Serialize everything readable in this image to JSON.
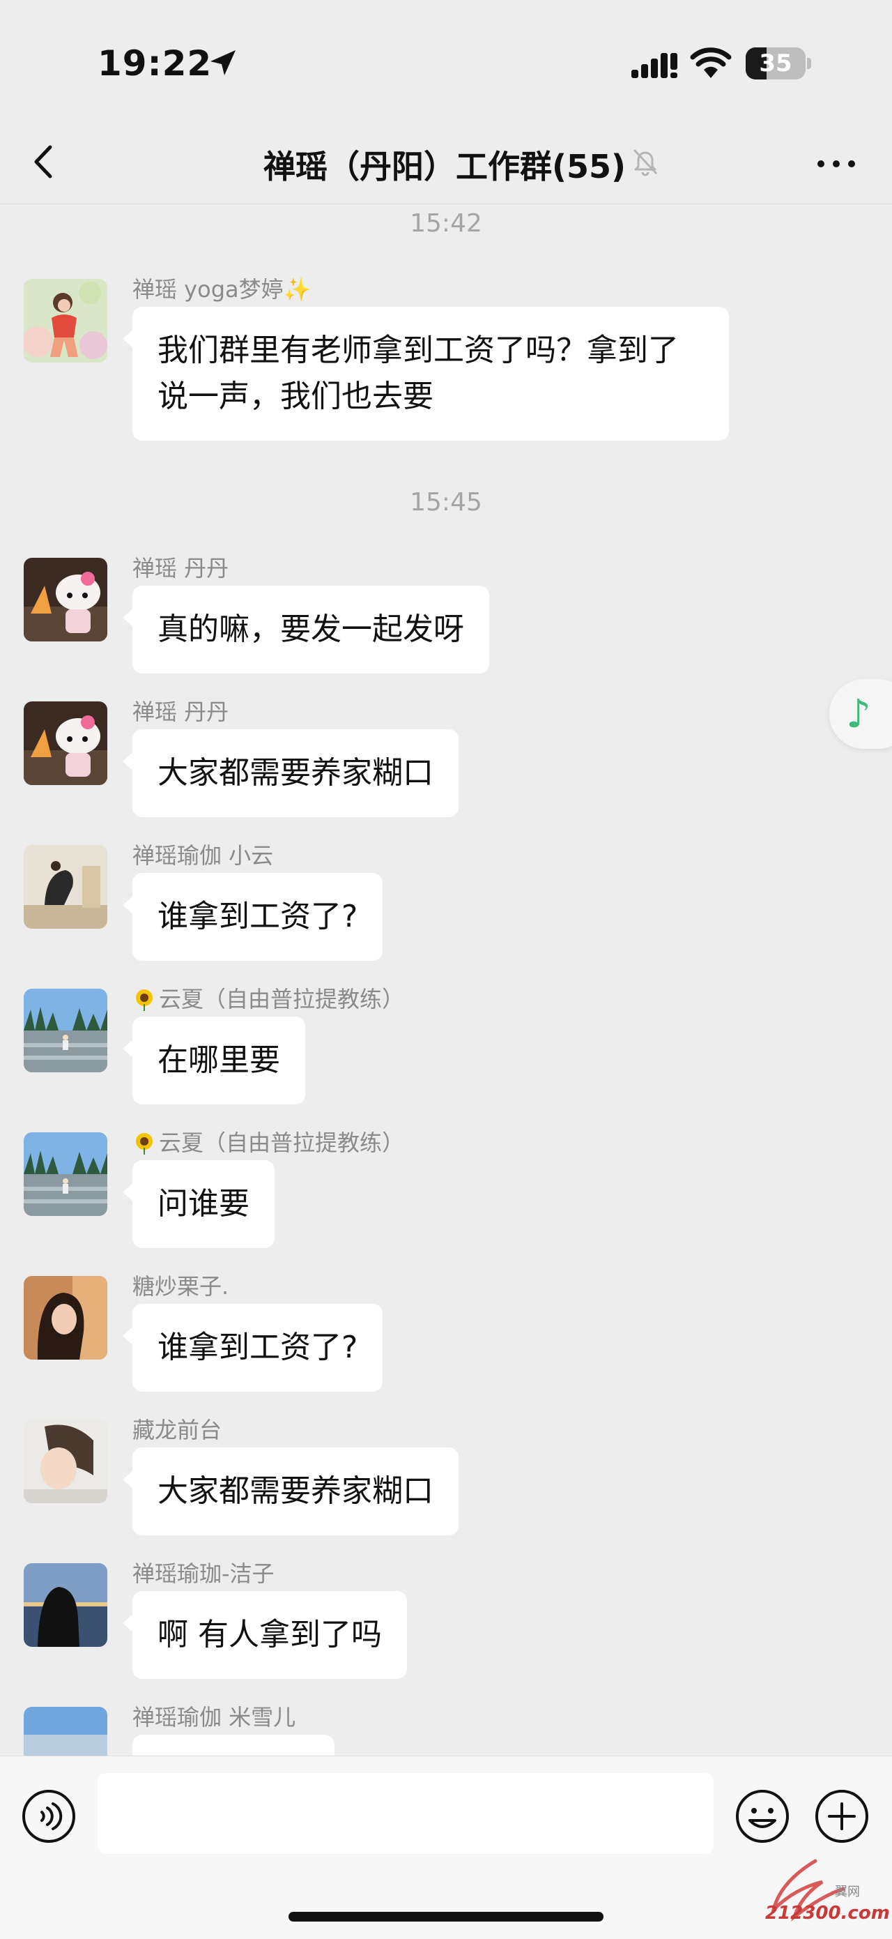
{
  "status_bar": {
    "time": "19:22",
    "battery_level": "35",
    "battery_fraction": 0.35
  },
  "header": {
    "back_icon": "chevron-left-icon",
    "title": "禅瑶（丹阳）工作群(55)",
    "mute_icon": "bell-slash-icon",
    "more_icon": "ellipsis-icon"
  },
  "chat": {
    "timestamps": [
      "15:42",
      "15:45"
    ],
    "messages": [
      {
        "sender": "禅瑶 yoga梦婷✨",
        "text": "我们群里有老师拿到工资了吗？拿到了说一声，我们也去要",
        "avatar": "avatar-illustrated-woman"
      },
      {
        "sender": "禅瑶 丹丹",
        "text": "真的嘛，要发一起发呀",
        "avatar": "avatar-hello-kitty"
      },
      {
        "sender": "禅瑶 丹丹",
        "text": "大家都需要养家糊口",
        "avatar": "avatar-hello-kitty"
      },
      {
        "sender": "禅瑶瑜伽 小云",
        "text": "谁拿到工资了?",
        "avatar": "avatar-yoga-pose"
      },
      {
        "sender": "云夏（自由普拉提教练）",
        "text": "在哪里要",
        "avatar": "avatar-lake-view",
        "emoji": "sunflower-icon"
      },
      {
        "sender": "云夏（自由普拉提教练）",
        "text": "问谁要",
        "avatar": "avatar-lake-view",
        "emoji": "sunflower-icon"
      },
      {
        "sender": "糖炒栗子.",
        "text": "谁拿到工资了?",
        "avatar": "avatar-woman-portrait"
      },
      {
        "sender": "藏龙前台",
        "text": "大家都需要养家糊口",
        "avatar": "avatar-child-portrait"
      },
      {
        "sender": "禅瑶瑜珈-洁子",
        "text": "啊  有人拿到了吗",
        "avatar": "avatar-sunset-silhouette"
      },
      {
        "sender": "禅瑶瑜伽 米雪儿",
        "text": "",
        "avatar": "avatar-sky"
      }
    ],
    "music_icon": "music-note-icon"
  },
  "input_bar": {
    "voice_icon": "voice-icon",
    "input_value": "",
    "emoji_icon": "smiley-icon",
    "add_icon": "plus-circle-icon"
  },
  "watermark": {
    "domain": "212300.com",
    "cn": "翼网"
  },
  "colors": {
    "background": "#ededed",
    "bubble": "#ffffff",
    "music_accent": "#3dbb7b",
    "watermark_red": "#c83a3a"
  }
}
